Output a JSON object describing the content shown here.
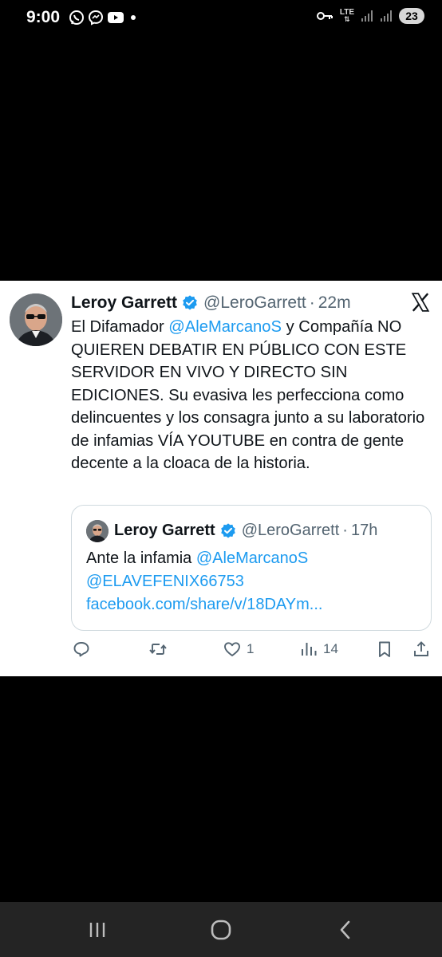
{
  "status_bar": {
    "time": "9:00",
    "network": "LTE",
    "battery": "23",
    "icons": [
      "whatsapp-icon",
      "messenger-icon",
      "youtube-icon",
      "notification-dot-icon",
      "vpn-key-icon",
      "signal-icon",
      "signal-icon",
      "battery-icon"
    ]
  },
  "tweet": {
    "name": "Leroy Garrett",
    "handle": "@LeroGarrett",
    "separator": "·",
    "time": "22m",
    "text_parts": {
      "p1": "El Difamador ",
      "mention": "@AleMarcanoS",
      "p2": " y Compañía NO QUIEREN DEBATIR EN PÚBLICO CON ESTE SERVIDOR EN VIVO Y DIRECTO SIN EDICIONES. Su evasiva les perfecciona como delincuentes y los consagra junto a su laboratorio de infamias VÍA YOUTUBE en contra de gente decente a la cloaca de la historia."
    },
    "quote": {
      "name": "Leroy Garrett",
      "handle": "@LeroGarrett",
      "separator": "·",
      "time": "17h",
      "text": "Ante la infamia ",
      "mention1": "@AleMarcanoS",
      "mention2": "@ELAVEFENIX66753",
      "link": "facebook.com/share/v/18DAYm..."
    },
    "actions": {
      "reply_count": "",
      "retweet_count": "",
      "like_count": "1",
      "views_count": "14"
    }
  },
  "colors": {
    "accent": "#1d9bf0",
    "text": "#0f1419",
    "muted": "#536471",
    "border": "#cfd9de"
  }
}
